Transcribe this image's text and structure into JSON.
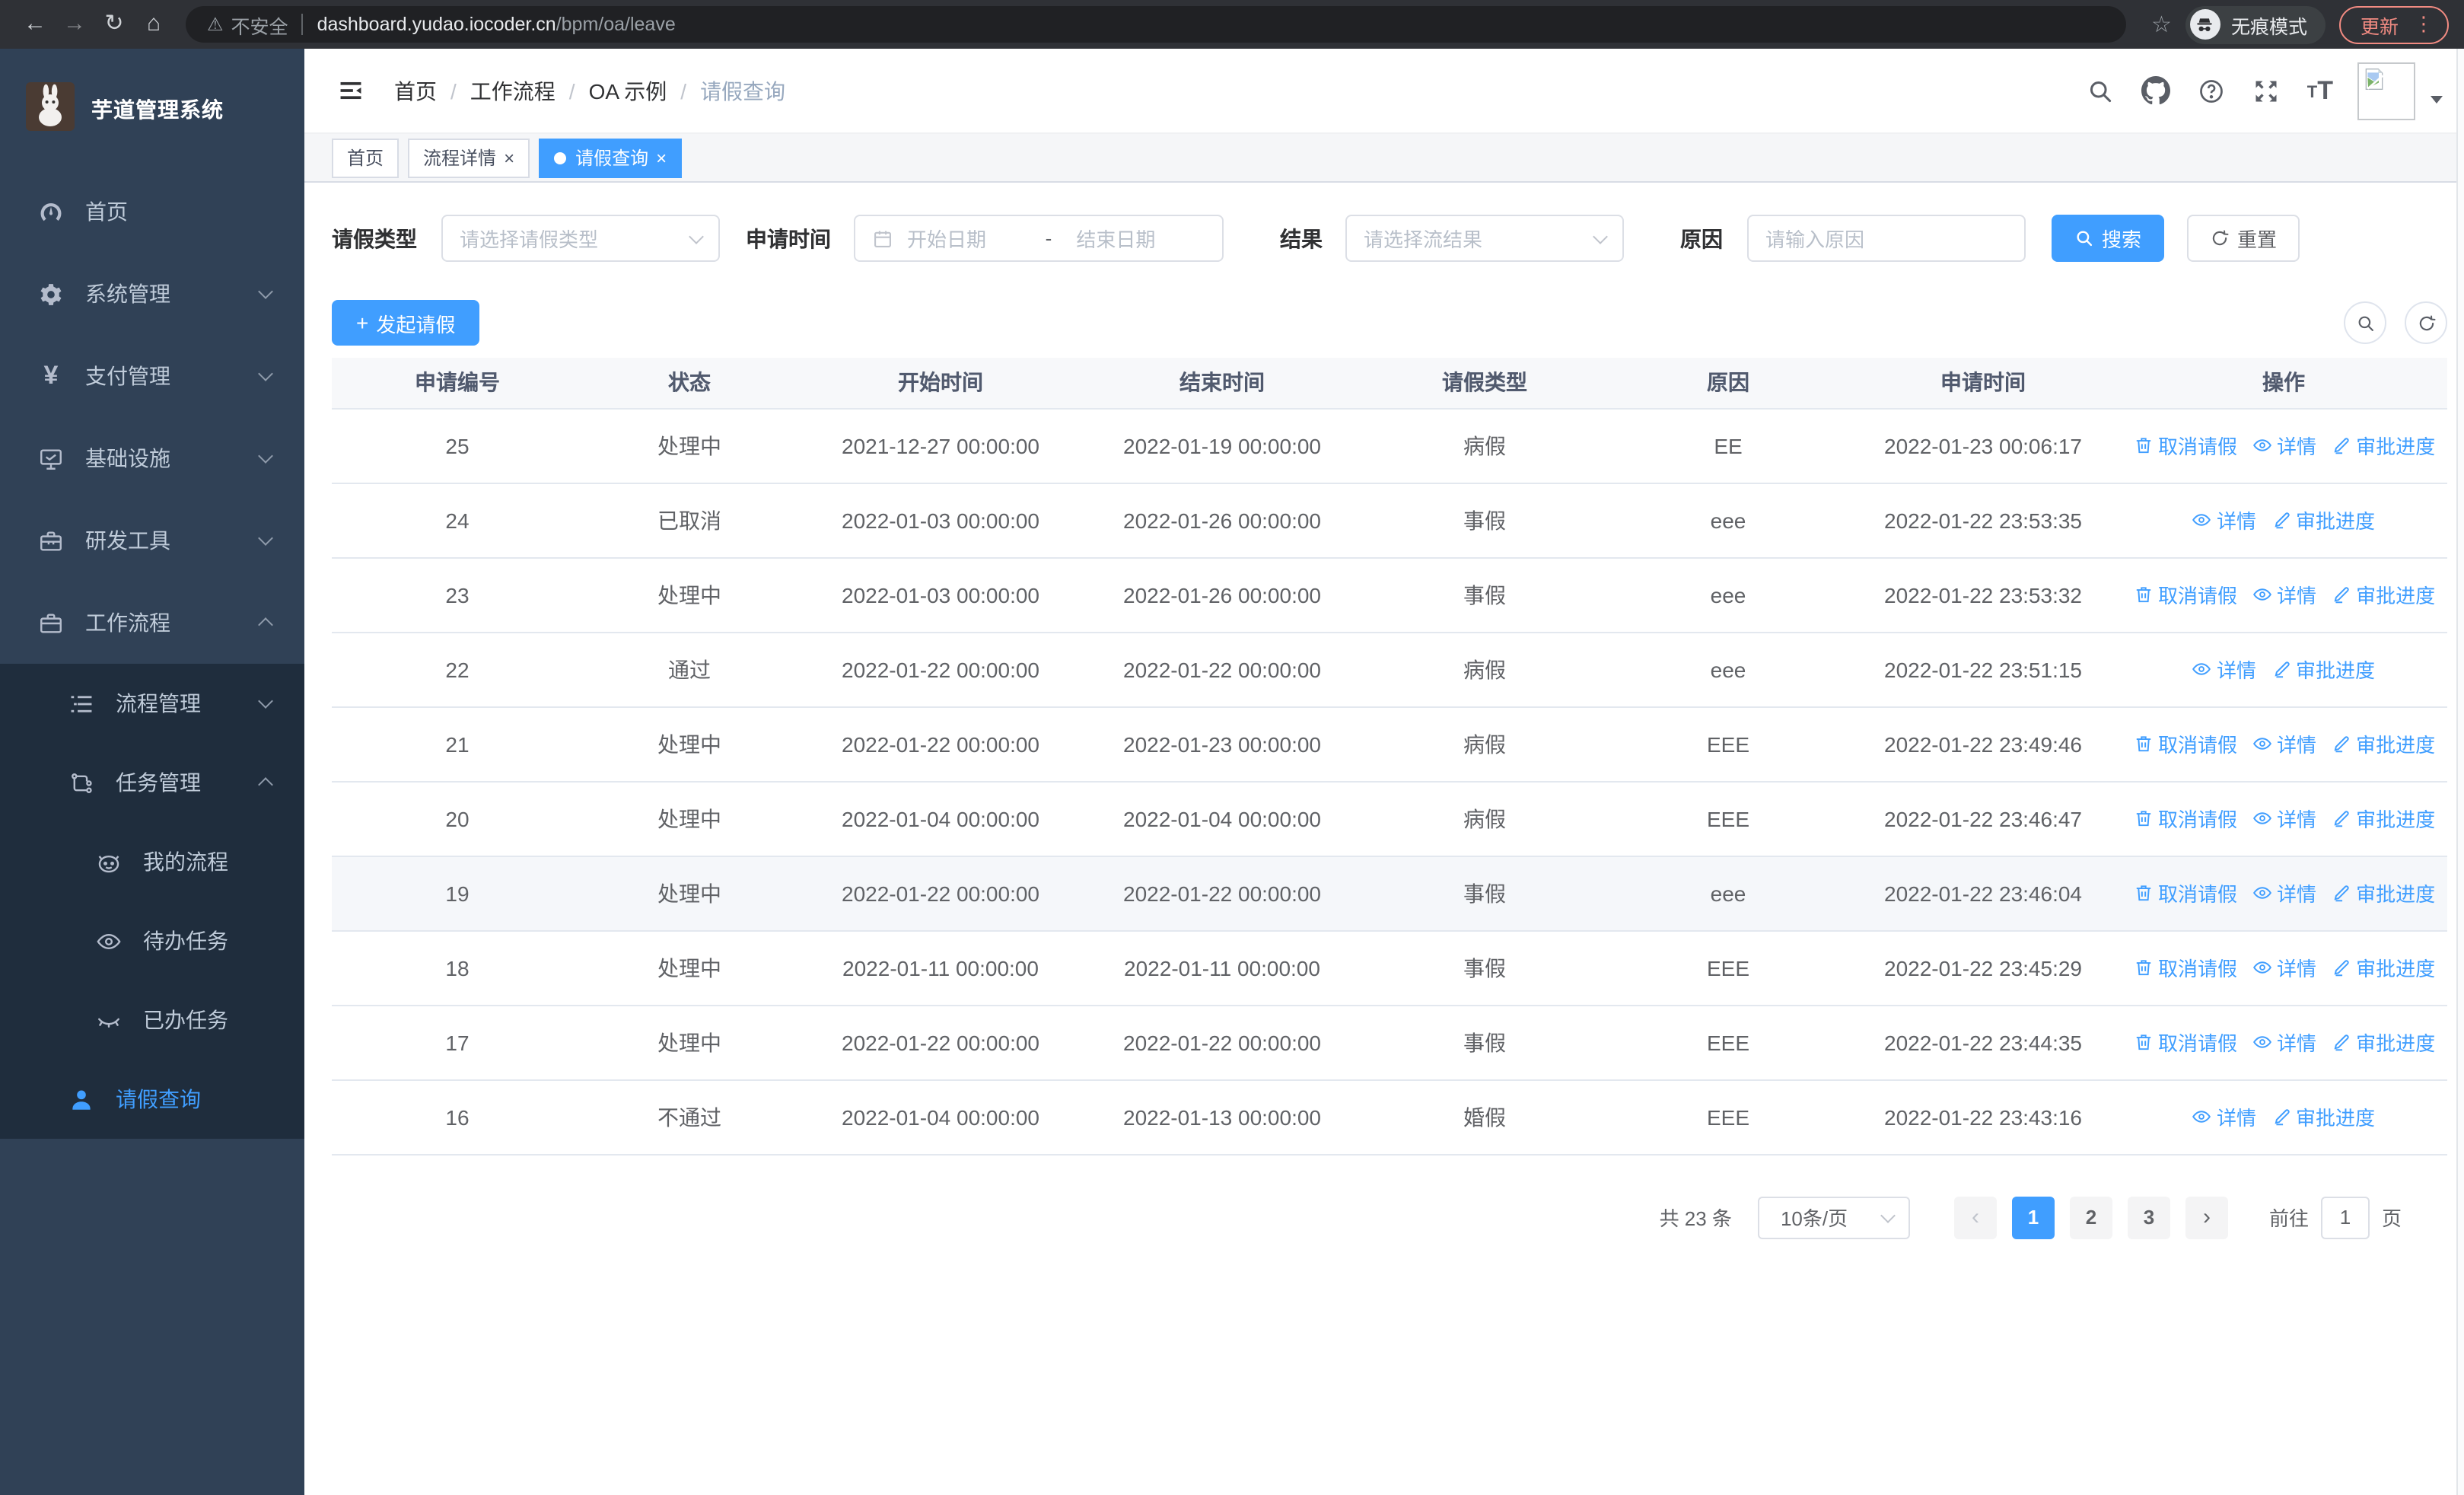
{
  "browser": {
    "security_label": "不安全",
    "url_host": "dashboard.yudao.iocoder.cn",
    "url_path": "/bpm/oa/leave",
    "incognito_label": "无痕模式",
    "update_label": "更新"
  },
  "theme": {
    "accent": "#409eff",
    "sidebar_bg": "#304156",
    "submenu_bg": "#1f2d3d",
    "menu_text": "#bfcbd9",
    "update_color": "#f28b82"
  },
  "sidebar": {
    "title": "芋道管理系统",
    "menu": [
      {
        "key": "home",
        "label": "首页",
        "icon": "dashboard-icon",
        "level": 1
      },
      {
        "key": "system",
        "label": "系统管理",
        "icon": "gear-icon",
        "level": 1,
        "chevron": "down"
      },
      {
        "key": "payment",
        "label": "支付管理",
        "icon": "yen-icon",
        "level": 1,
        "chevron": "down"
      },
      {
        "key": "infrastructure",
        "label": "基础设施",
        "icon": "monitor-icon",
        "level": 1,
        "chevron": "down"
      },
      {
        "key": "devtools",
        "label": "研发工具",
        "icon": "toolbox-icon",
        "level": 1,
        "chevron": "down"
      },
      {
        "key": "workflow",
        "label": "工作流程",
        "icon": "briefcase-icon",
        "level": 1,
        "chevron": "up"
      },
      {
        "key": "process-management",
        "label": "流程管理",
        "icon": "list-tree-icon",
        "level": 2,
        "chevron": "down",
        "in_group": true
      },
      {
        "key": "task-management",
        "label": "任务管理",
        "icon": "workflow-icon",
        "level": 2,
        "chevron": "up",
        "in_group": true
      },
      {
        "key": "my-process",
        "label": "我的流程",
        "icon": "robot-icon",
        "level": 3,
        "in_group": true
      },
      {
        "key": "todo-task",
        "label": "待办任务",
        "icon": "eye-icon",
        "level": 3,
        "in_group": true
      },
      {
        "key": "done-task",
        "label": "已办任务",
        "icon": "eye-closed-icon",
        "level": 3,
        "in_group": true
      },
      {
        "key": "leave-query",
        "label": "请假查询",
        "icon": "user-icon",
        "level": 2,
        "active": true,
        "in_group": true
      }
    ]
  },
  "header": {
    "breadcrumb": {
      "items": [
        "首页",
        "工作流程",
        "OA 示例",
        "请假查询"
      ],
      "separator": "/"
    }
  },
  "tabs": [
    {
      "key": "home",
      "label": "首页"
    },
    {
      "key": "process-detail",
      "label": "流程详情",
      "closable": true
    },
    {
      "key": "leave-query",
      "label": "请假查询",
      "closable": true,
      "active": true
    }
  ],
  "filters": {
    "leave_type": {
      "label": "请假类型",
      "placeholder": "请选择请假类型"
    },
    "apply_time": {
      "label": "申请时间",
      "start_placeholder": "开始日期",
      "separator": "-",
      "end_placeholder": "结束日期"
    },
    "result": {
      "label": "结果",
      "placeholder": "请选择流结果"
    },
    "reason": {
      "label": "原因",
      "placeholder": "请输入原因"
    },
    "search_label": "搜索",
    "reset_label": "重置"
  },
  "toolbar": {
    "create_label": "发起请假"
  },
  "table": {
    "columns": [
      "申请编号",
      "状态",
      "开始时间",
      "结束时间",
      "请假类型",
      "原因",
      "申请时间",
      "操作"
    ],
    "action_defs": {
      "cancel": {
        "label": "取消请假",
        "icon": "trash-icon"
      },
      "detail": {
        "label": "详情",
        "icon": "eye-view-icon"
      },
      "progress": {
        "label": "审批进度",
        "icon": "edit-icon"
      }
    },
    "rows": [
      {
        "id": "25",
        "status": "处理中",
        "start": "2021-12-27 00:00:00",
        "end": "2022-01-19 00:00:00",
        "type": "病假",
        "reason": "EE",
        "applied": "2022-01-23 00:06:17",
        "actions": [
          "cancel",
          "detail",
          "progress"
        ]
      },
      {
        "id": "24",
        "status": "已取消",
        "start": "2022-01-03 00:00:00",
        "end": "2022-01-26 00:00:00",
        "type": "事假",
        "reason": "eee",
        "applied": "2022-01-22 23:53:35",
        "actions": [
          "detail",
          "progress"
        ]
      },
      {
        "id": "23",
        "status": "处理中",
        "start": "2022-01-03 00:00:00",
        "end": "2022-01-26 00:00:00",
        "type": "事假",
        "reason": "eee",
        "applied": "2022-01-22 23:53:32",
        "actions": [
          "cancel",
          "detail",
          "progress"
        ]
      },
      {
        "id": "22",
        "status": "通过",
        "start": "2022-01-22 00:00:00",
        "end": "2022-01-22 00:00:00",
        "type": "病假",
        "reason": "eee",
        "applied": "2022-01-22 23:51:15",
        "actions": [
          "detail",
          "progress"
        ]
      },
      {
        "id": "21",
        "status": "处理中",
        "start": "2022-01-22 00:00:00",
        "end": "2022-01-23 00:00:00",
        "type": "病假",
        "reason": "EEE",
        "applied": "2022-01-22 23:49:46",
        "actions": [
          "cancel",
          "detail",
          "progress"
        ]
      },
      {
        "id": "20",
        "status": "处理中",
        "start": "2022-01-04 00:00:00",
        "end": "2022-01-04 00:00:00",
        "type": "病假",
        "reason": "EEE",
        "applied": "2022-01-22 23:46:47",
        "actions": [
          "cancel",
          "detail",
          "progress"
        ]
      },
      {
        "id": "19",
        "status": "处理中",
        "start": "2022-01-22 00:00:00",
        "end": "2022-01-22 00:00:00",
        "type": "事假",
        "reason": "eee",
        "applied": "2022-01-22 23:46:04",
        "actions": [
          "cancel",
          "detail",
          "progress"
        ],
        "highlight": true
      },
      {
        "id": "18",
        "status": "处理中",
        "start": "2022-01-11 00:00:00",
        "end": "2022-01-11 00:00:00",
        "type": "事假",
        "reason": "EEE",
        "applied": "2022-01-22 23:45:29",
        "actions": [
          "cancel",
          "detail",
          "progress"
        ]
      },
      {
        "id": "17",
        "status": "处理中",
        "start": "2022-01-22 00:00:00",
        "end": "2022-01-22 00:00:00",
        "type": "事假",
        "reason": "EEE",
        "applied": "2022-01-22 23:44:35",
        "actions": [
          "cancel",
          "detail",
          "progress"
        ]
      },
      {
        "id": "16",
        "status": "不通过",
        "start": "2022-01-04 00:00:00",
        "end": "2022-01-13 00:00:00",
        "type": "婚假",
        "reason": "EEE",
        "applied": "2022-01-22 23:43:16",
        "actions": [
          "detail",
          "progress"
        ]
      }
    ]
  },
  "pagination": {
    "total_label": "共 23 条",
    "page_size_label": "10条/页",
    "pages": [
      "1",
      "2",
      "3"
    ],
    "current_page": "1",
    "goto_label": "前往",
    "goto_value": "1",
    "page_unit": "页"
  }
}
